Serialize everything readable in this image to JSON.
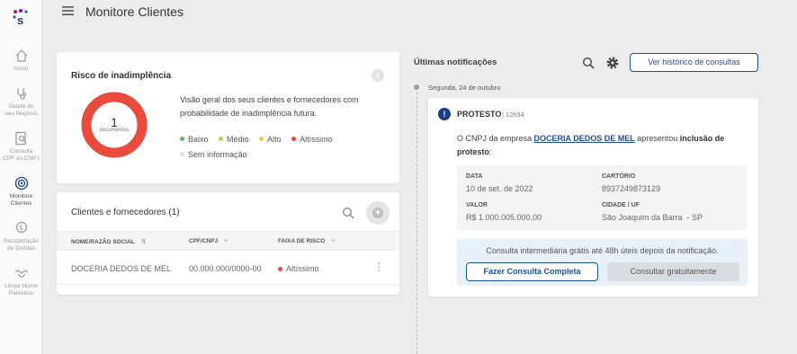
{
  "sidebar": {
    "logo": "logo-icon",
    "items": [
      {
        "label": "Início",
        "icon": "home-icon"
      },
      {
        "label": "Saúde do\nseu Negócio",
        "icon": "stethoscope-icon"
      },
      {
        "label": "Consulta\nCPF ou CNPJ",
        "icon": "document-search-icon"
      },
      {
        "label": "Monitore\nClientes",
        "icon": "radar-icon",
        "active": true
      },
      {
        "label": "Recuperação\nde Dívidas",
        "icon": "coin-icon"
      },
      {
        "label": "Limpa Nome\nParceiros",
        "icon": "handshake-icon"
      }
    ]
  },
  "header": {
    "title": "Monitore Clientes"
  },
  "risk": {
    "title": "Risco de inadimplência",
    "count": "1",
    "count_label": "documentos",
    "description": "Visão geral dos seus clientes e fornecedores com probabilidade de inadimplência futura.",
    "legend": [
      {
        "label": "Baixo",
        "color": "#5cb85c"
      },
      {
        "label": "Médio",
        "color": "#a8d65a"
      },
      {
        "label": "Alto",
        "color": "#f2c94c"
      },
      {
        "label": "Altíssimo",
        "color": "#eb4b3d"
      },
      {
        "label": "Sem informação",
        "color": "#dddddd"
      }
    ],
    "donut_color": "#eb4b3d"
  },
  "clients": {
    "title": "Clientes e fornecedores (1)",
    "columns": [
      "NOME/RAZÃO SOCIAL",
      "CPF/CNPJ",
      "FAIXA DE RISCO"
    ],
    "rows": [
      {
        "name": "DOCERIA DEDOS DE MEL",
        "doc": "00.000.000/0000-00",
        "risk": "Altíssimo"
      }
    ]
  },
  "notifications": {
    "title": "Últimas notificações",
    "history_button": "Ver histórico de consultas",
    "date": "Segunda, 24 de outubro",
    "item": {
      "type": "PROTESTO",
      "time": "| 12h34",
      "text_prefix": "O CNPJ da empresa ",
      "company": "DOCERIA DEDOS DE MEL",
      "text_middle": " apresentou ",
      "text_bold": "inclusão de protesto",
      "text_suffix": ":",
      "data_label": "DATA",
      "data_value": "10 de set. de 2022",
      "cartorio_label": "CARTÓRIO",
      "cartorio_value": "8937249873129",
      "valor_label": "VALOR",
      "valor_value": "R$ 1.000.005.000,00",
      "cidade_label": "CIDADE / UF",
      "cidade_value": "São Joaquim da Barra  - SP",
      "cta_text": "Consulta intermediária grátis até 48h úteis depois da notificação.",
      "btn_full": "Fazer Consulta Completa",
      "btn_free": "Consultar gratuitamente"
    }
  }
}
